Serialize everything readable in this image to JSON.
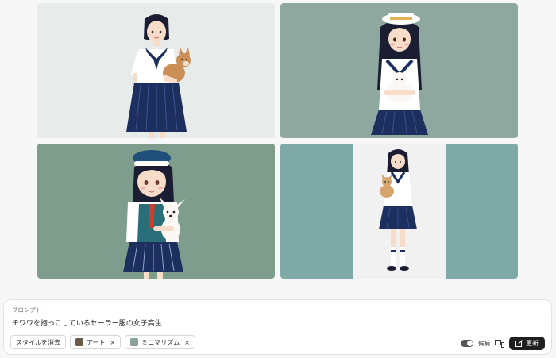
{
  "images": [
    {
      "background": "#e7ebea"
    },
    {
      "background": "#8ea89f"
    },
    {
      "background": "#7f9d8d"
    },
    {
      "background": "#7ea9a7"
    }
  ],
  "prompt": {
    "label": "プロンプト",
    "text": "チワワを抱っこしているセーラー服の女子高生"
  },
  "chips": [
    {
      "label": "スタイルを消去",
      "thumbnail": false,
      "removable": false
    },
    {
      "label": "アート",
      "thumbnail": true,
      "thumb_color": "#6b5a4a",
      "removable": true,
      "remove_symbol": "×"
    },
    {
      "label": "ミニマリズム",
      "thumbnail": true,
      "thumb_color": "#8aa39a",
      "removable": true,
      "remove_symbol": "×"
    }
  ],
  "controls": {
    "toggle_label": "候補",
    "toggle_on": true,
    "update_label": "更新"
  },
  "colors": {
    "navy": "#1d2f5e",
    "update_button": "#1f1f1f"
  }
}
